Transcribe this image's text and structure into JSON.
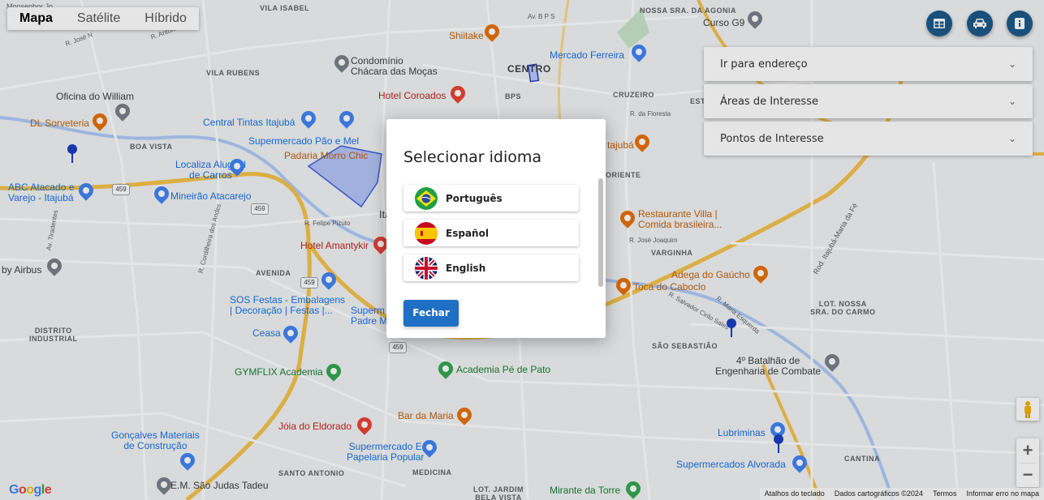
{
  "map": {
    "type_control": {
      "map": "Mapa",
      "satellite": "Satélite",
      "hybrid": "Híbrido"
    },
    "places": {
      "vila_isabel": "VILA ISABEL",
      "nossa_sra_agonia": "NOSSA SRA. DA AGONIA",
      "shiitake": "Shiitake",
      "curso": "Curso G9",
      "centro": "CENTRO",
      "mercado_ferreira": "Mercado Ferreira",
      "condominio": "Condomínio\nChácara das Moças",
      "vila_rubens": "VILA RUBENS",
      "hotel_coroados": "Hotel Coroados",
      "bps": "BPS",
      "cruzeiro": "CRUZEIRO",
      "oficina": "Oficina do William",
      "dl_sorveteria": "DL Sorveteria",
      "central_tintas": "Central Tintas Itajubá",
      "supermercado_pao": "Supermercado Pão e Mel",
      "padaria": "Padaria Morro Chic",
      "boa_vista": "BOA VISTA",
      "localiza": "Localiza Aluguel\nde Carros",
      "abc_atacado": "ABC Atacado e\nVarejo - Itajubá",
      "mineirao": "Mineirão Atacarejo",
      "hotel_amantykir": "Hotel Amantykir",
      "airbus": "by Airbus",
      "avenida": "AVENIDA",
      "sos_festas": "SOS Festas - Embalagens\n| Decoração | Festas |...",
      "ceasa": "Ceasa",
      "distrito": "DISTRITO\nINDUSTRIAL",
      "gymflix": "GYMFLIX Academia",
      "academia_pe_pato": "Academia Pé de Pato",
      "restaurante_villa": "Restaurante Villa |\nComida brasileira...",
      "varginha": "VARGINHA",
      "adega": "Adega do Gaúcho",
      "toca": "Toca do Caboclo",
      "lot_nossa": "LOT. NOSSA\nSRA. DO CARMO",
      "sao_sebastiao": "SÃO SEBASTIÃO",
      "batalhao": "4º Batalhão de\nEngenharia de Combate",
      "joia": "Jóia do Eldorado",
      "bar_maria": "Bar da Maria",
      "goncalves": "Gonçalves Materiais\nde Construção",
      "supermercado_popular": "Supermercado E\nPapelaria Popular",
      "lubriminas": "Lubriminas",
      "supermercados_alvorada": "Supermercados Alvorada",
      "santo_antonio": "SANTO ANTONIO",
      "medicina": "MEDICINA",
      "em_sao_judas": "E.M. São Judas Tadeu",
      "lot_jardim": "LOT. JARDIM\nBELA VISTA",
      "mirante": "Mirante da Torre",
      "cantina": "CANTINA",
      "itajuba_partial": "Ita",
      "supermercado_padre": "Superm\nPadre M",
      "oriente": "ORIENTE",
      "itajuba_partial2": "tajubá",
      "estacao": "ESTA",
      "rod_itajuba": "Rod. Itajubá-Maria da Fé",
      "av_bps": "Av. B P S",
      "r_felipe": "R. Felipe Pizuto",
      "r_jose_joaquim": "R. José Joaquim",
      "r_salvador": "R. Salvador Cirilo Sales",
      "r_maria_esquerda": "R. Maria Esquerda",
      "av_tiradentes": "Av. Tiradentes",
      "r_cordilheira": "R. Cordilheira dos Andes",
      "r_floresta": "R. da Floresta",
      "r_antonio": "R. Antônio Li",
      "r_jose_n": "R. José N",
      "monsenhor": "Monsenhor Jo"
    },
    "route_shields": [
      "459",
      "459",
      "459",
      "459"
    ],
    "google": "Google",
    "footer": {
      "shortcuts": "Atalhos do teclado",
      "data": "Dados cartográficos ©2024",
      "terms": "Termos",
      "report": "Informar erro no mapa"
    },
    "zoom": {
      "in": "+",
      "out": "−"
    }
  },
  "toolbar": {
    "buttons": [
      {
        "icon": "table-icon"
      },
      {
        "icon": "car-icon"
      },
      {
        "icon": "info-icon"
      }
    ]
  },
  "panels": [
    {
      "label": "Ir para endereço"
    },
    {
      "label": "Áreas de Interesse"
    },
    {
      "label": "Pontos de Interesse"
    }
  ],
  "modal": {
    "title": "Selecionar idioma",
    "languages": [
      {
        "label": "Português",
        "flag": "brazil-flag-icon"
      },
      {
        "label": "Español",
        "flag": "spain-flag-icon"
      },
      {
        "label": "English",
        "flag": "uk-flag-icon"
      }
    ],
    "close_label": "Fechar"
  },
  "colors": {
    "primary": "#1f6fc5",
    "toolbar_button": "#1c5a8a",
    "map_bg": "#f1f3f4",
    "highway": "#f5c24c"
  }
}
